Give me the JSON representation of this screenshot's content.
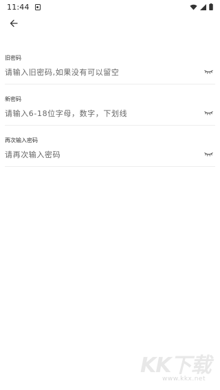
{
  "status_bar": {
    "time": "11:44"
  },
  "icons": {
    "back": "arrow-left-icon",
    "eye": "eye-closed-icon"
  },
  "fields": [
    {
      "label": "旧密码",
      "placeholder": "请输入旧密码,如果没有可以留空"
    },
    {
      "label": "新密码",
      "placeholder": "请输入6-18位字母，数字，下划线"
    },
    {
      "label": "再次输入密码",
      "placeholder": "请再次输入密码"
    }
  ],
  "watermark": {
    "logo": "KK下载",
    "url": "www.kkx.net"
  }
}
